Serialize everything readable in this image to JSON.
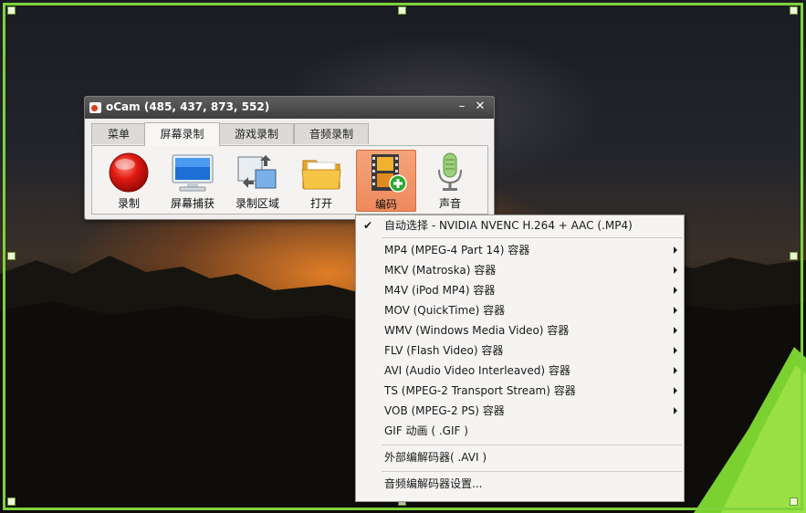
{
  "window": {
    "title": "oCam (485, 437, 873, 552)",
    "minimize_glyph": "–",
    "close_glyph": "✕"
  },
  "tabs": [
    {
      "label": "菜单"
    },
    {
      "label": "屏幕录制",
      "active": true
    },
    {
      "label": "游戏录制"
    },
    {
      "label": "音频录制"
    }
  ],
  "toolbar": [
    {
      "label": "录制",
      "icon": "record-icon"
    },
    {
      "label": "屏幕捕获",
      "icon": "monitor-icon"
    },
    {
      "label": "录制区域",
      "icon": "region-icon"
    },
    {
      "label": "打开",
      "icon": "folder-icon"
    },
    {
      "label": "编码",
      "icon": "film-add-icon",
      "active": true
    },
    {
      "label": "声音",
      "icon": "microphone-icon"
    }
  ],
  "menu": {
    "auto_select": "自动选择 - NVIDIA NVENC H.264 + AAC (.MP4)",
    "check_glyph": "✔",
    "containers": [
      "MP4 (MPEG-4 Part 14) 容器",
      "MKV (Matroska) 容器",
      "M4V (iPod MP4) 容器",
      "MOV (QuickTime) 容器",
      "WMV (Windows Media Video) 容器",
      "FLV (Flash Video) 容器",
      "AVI (Audio Video Interleaved) 容器",
      "TS (MPEG-2 Transport Stream) 容器",
      "VOB (MPEG-2 PS) 容器"
    ],
    "gif": "GIF 动画 ( .GIF )",
    "external": "外部编解码器( .AVI )",
    "audio_settings": "音频编解码器设置..."
  },
  "colors": {
    "frame": "#7fd23a",
    "active_tool": "#ee8a5d"
  }
}
